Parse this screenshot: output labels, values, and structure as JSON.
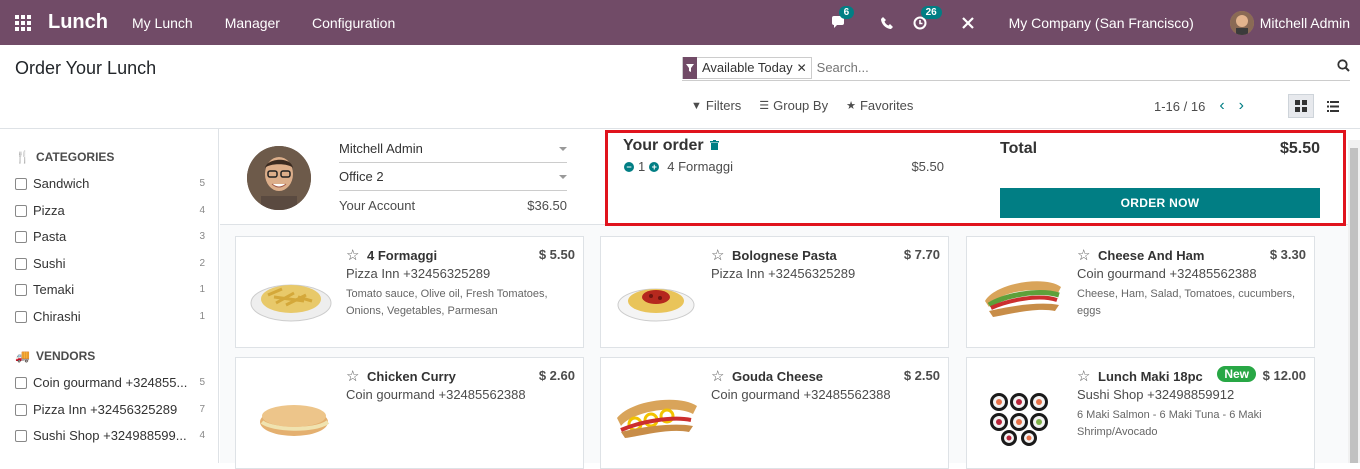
{
  "navbar": {
    "app_name": "Lunch",
    "menus": [
      "My Lunch",
      "Manager",
      "Configuration"
    ],
    "chat_count": "6",
    "activity_count": "26",
    "company": "My Company (San Francisco)",
    "user": "Mitchell Admin"
  },
  "control": {
    "title": "Order Your Lunch",
    "facet": "Available Today",
    "search_placeholder": "Search...",
    "filters_label": "Filters",
    "groupby_label": "Group By",
    "favorites_label": "Favorites",
    "pager": "1-16 / 16"
  },
  "sidebar": {
    "categories_title": "CATEGORIES",
    "categories": [
      {
        "label": "Sandwich",
        "count": "5"
      },
      {
        "label": "Pizza",
        "count": "4"
      },
      {
        "label": "Pasta",
        "count": "3"
      },
      {
        "label": "Sushi",
        "count": "2"
      },
      {
        "label": "Temaki",
        "count": "1"
      },
      {
        "label": "Chirashi",
        "count": "1"
      }
    ],
    "vendors_title": "VENDORS",
    "vendors": [
      {
        "label": "Coin gourmand +324855...",
        "count": "5"
      },
      {
        "label": "Pizza Inn +32456325289",
        "count": "7"
      },
      {
        "label": "Sushi Shop +324988599...",
        "count": "4"
      }
    ]
  },
  "user_panel": {
    "user": "Mitchell Admin",
    "location": "Office 2",
    "account_label": "Your Account",
    "account_value": "$36.50"
  },
  "order": {
    "title": "Your order",
    "line": {
      "qty": "1",
      "product": "4 Formaggi",
      "price": "$5.50"
    },
    "total_label": "Total",
    "total_value": "$5.50",
    "order_button": "ORDER NOW"
  },
  "products": [
    {
      "name": "4 Formaggi",
      "price": "$ 5.50",
      "vendor": "Pizza Inn +32456325289",
      "desc": "Tomato sauce, Olive oil, Fresh Tomatoes, Onions, Vegetables, Parmesan",
      "image": "pasta"
    },
    {
      "name": "Bolognese Pasta",
      "price": "$ 7.70",
      "vendor": "Pizza Inn +32456325289",
      "desc": "",
      "image": "pasta-red"
    },
    {
      "name": "Cheese And Ham",
      "price": "$ 3.30",
      "vendor": "Coin gourmand +32485562388",
      "desc": "Cheese, Ham, Salad, Tomatoes, cucumbers, eggs",
      "image": "sandwich"
    },
    {
      "name": "Chicken Curry",
      "price": "$ 2.60",
      "vendor": "Coin gourmand +32485562388",
      "desc": "",
      "image": "sandwich-bun"
    },
    {
      "name": "Gouda Cheese",
      "price": "$ 2.50",
      "vendor": "Coin gourmand +32485562388",
      "desc": "",
      "image": "sandwich-egg"
    },
    {
      "name": "Lunch Maki 18pc",
      "price": "$ 12.00",
      "vendor": "Sushi Shop +32498859912",
      "desc": "6 Maki Salmon - 6 Maki Tuna - 6 Maki Shrimp/Avocado",
      "image": "sushi",
      "badge": "New"
    }
  ],
  "colors": {
    "brand": "#714b67",
    "accent": "#017e84",
    "highlight": "#e0131d"
  }
}
